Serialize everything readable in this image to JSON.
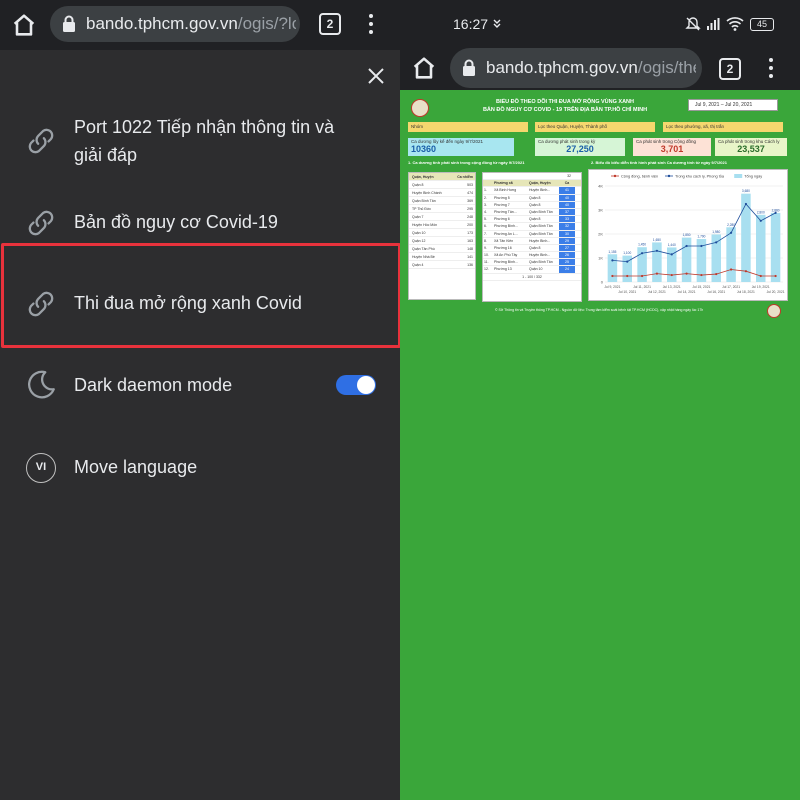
{
  "left": {
    "url_host": "bando.tphcm.gov.vn",
    "url_path": "/ogis/?lc",
    "tab_count": "2",
    "menu": [
      {
        "label_line1": "Port 1022 Tiếp nhận thông tin và",
        "label_line2": "giải đáp",
        "icon": "link-icon"
      },
      {
        "label": "Bản đồ nguy cơ Covid-19",
        "icon": "link-icon"
      },
      {
        "label": "Thi đua mở rộng xanh Covid",
        "icon": "link-icon",
        "highlighted": true
      },
      {
        "label": "Dark daemon mode",
        "icon": "moon-icon",
        "toggle_on": true
      },
      {
        "label": "Move language",
        "badge": "VI"
      }
    ]
  },
  "right": {
    "status_time": "16:27",
    "battery": "45",
    "url_host": "bando.tphcm.gov.vn",
    "url_path": "/ogis/the",
    "tab_count": "2",
    "dashboard": {
      "title_line1": "BIỂU ĐỒ THEO DÕI THI ĐUA MỞ RỘNG VÙNG XANH",
      "title_line2": "BẢN ĐỒ NGUY CƠ COVID - 19 TRÊN ĐỊA BÀN TP.HỒ CHÍ MINH",
      "date_range": "Jul 9, 2021 – Jul 20, 2021",
      "filters": [
        "Nhóm",
        "Lọc theo Quận, Huyện, Thành phố",
        "Lọc theo phường, xã, thị trấn"
      ],
      "kpis": [
        {
          "label": "Ca dương lũy kế đến ngày 9/7/2021",
          "value": "10360"
        },
        {
          "label": "Ca dương phát sinh trong kỳ",
          "value": "27,250"
        },
        {
          "label": "Ca phát sinh trong Cộng đồng",
          "value": "3,701"
        },
        {
          "label": "Ca phát sinh trong khu Cách ly",
          "value": "23,537"
        }
      ],
      "section1_title": "1. Ca dương tính phát sinh trong cộng đồng từ ngày 9/7/2021",
      "section2_title": "2. Biểu đồ biểu diễn tình hình phát sinh Ca dương tính từ ngày 9/7/2021",
      "table1_headers": [
        "Quận, Huyện",
        "Ca nhiễm"
      ],
      "table1_rows": [
        [
          "Quận 8",
          "503"
        ],
        [
          "Huyện Bình Chánh",
          "474"
        ],
        [
          "Quận Bình Tân",
          "369"
        ],
        [
          "TP Thủ Đức",
          "295"
        ],
        [
          "Quận 7",
          "248"
        ],
        [
          "Huyện Hóc Môn",
          "200"
        ],
        [
          "Quận 10",
          "173"
        ],
        [
          "Quận 12",
          "163"
        ],
        [
          "Quận Tân Phú",
          "148"
        ],
        [
          "Huyện Nhà Bè",
          "141"
        ],
        [
          "Quận 4",
          "136"
        ]
      ],
      "table2_pager_top": "32",
      "table2_headers": [
        "",
        "Phường xã",
        "Quận, Huyện",
        "Ca"
      ],
      "table2_rows": [
        [
          "1.",
          "Xã Bình Hưng",
          "Huyện Bình...",
          "41"
        ],
        [
          "2.",
          "Phường 5",
          "Quận 8",
          "40"
        ],
        [
          "3.",
          "Phường 7",
          "Quận 8",
          "40"
        ],
        [
          "4.",
          "Phường Tân...",
          "Quận Bình Tân",
          "37"
        ],
        [
          "5.",
          "Phường 6",
          "Quận 8",
          "33"
        ],
        [
          "6.",
          "Phường Bình...",
          "Quận Bình Tân",
          "32"
        ],
        [
          "7.",
          "Phường An L...",
          "Quận Bình Tân",
          "30"
        ],
        [
          "8.",
          "Xã Tân Kiên",
          "Huyện Bình...",
          "29"
        ],
        [
          "9.",
          "Phường 16",
          "Quận 8",
          "27"
        ],
        [
          "10.",
          "Xã An Phú Tây",
          "Huyện Bình...",
          "26"
        ],
        [
          "11.",
          "Phường Bình...",
          "Quận Bình Tân",
          "25"
        ],
        [
          "12.",
          "Phường 13",
          "Quận 10",
          "24"
        ]
      ],
      "table2_pager_bottom": "1 - 100 / 332",
      "legend": [
        "Cộng đồng, bệnh viện",
        "Trong khu cách ly, Phong tỏa",
        "Tổng ngày"
      ],
      "footer_note": "© Sở Thông tin và Truyền thông TP.HCM - Nguồn dữ liệu: Trung tâm kiểm soát bệnh tật TP.HCM (HCDC), cập nhật hàng ngày lúc 17h"
    }
  },
  "chart_data": {
    "type": "bar",
    "categories": [
      "Jul 9, 2021",
      "Jul 10, 2021",
      "Jul 11, 2021",
      "Jul 12, 2021",
      "Jul 13, 2021",
      "Jul 14, 2021",
      "Jul 15, 2021",
      "Jul 16, 2021",
      "Jul 17, 2021",
      "Jul 18, 2021",
      "Jul 19, 2021",
      "Jul 20, 2021"
    ],
    "x_tick_labels_bottom": [
      "Jul 9, 2021",
      "Jul 11, 2021",
      "Jul 13, 2021",
      "Jul 15, 2021",
      "Jul 17, 2021",
      "Jul 19, 2021"
    ],
    "x_tick_labels_top": [
      "Jul 10, 2021",
      "Jul 12, 2021",
      "Jul 14, 2021",
      "Jul 16, 2021",
      "Jul 18, 2021",
      "Jul 20, 2021"
    ],
    "series": [
      {
        "name": "Tổng ngày",
        "kind": "bar",
        "color": "#a8dff0",
        "values": [
          1155,
          1100,
          1450,
          1650,
          1440,
          1850,
          1790,
          1980,
          2280,
          3680,
          2800,
          2880
        ]
      },
      {
        "name": "Trong khu cách ly, Phong tỏa",
        "kind": "line",
        "color": "#1f4e9c",
        "values": [
          900,
          850,
          1200,
          1300,
          1150,
          1500,
          1500,
          1650,
          2050,
          3250,
          2550,
          2880
        ]
      },
      {
        "name": "Cộng đồng, bệnh viện",
        "kind": "line",
        "color": "#c0392b",
        "values": [
          250,
          250,
          250,
          350,
          290,
          350,
          290,
          330,
          520,
          450,
          250,
          250
        ]
      }
    ],
    "ylim": [
      0,
      4000
    ],
    "yticks": [
      "0",
      "1K",
      "2K",
      "3K",
      "4K"
    ],
    "legend_position": "top"
  }
}
